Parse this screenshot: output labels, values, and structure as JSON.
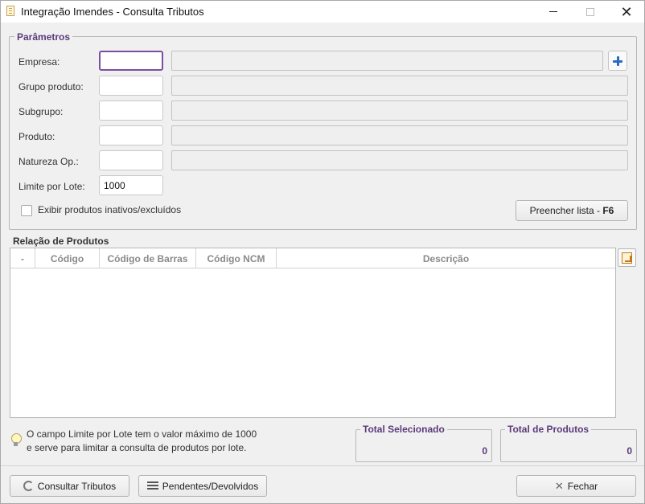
{
  "window": {
    "title": "Integração Imendes - Consulta Tributos",
    "close_glyph": "✕"
  },
  "params": {
    "legend": "Parâmetros",
    "fields": [
      {
        "label": "Empresa:",
        "code": ""
      },
      {
        "label": "Grupo produto:",
        "code": ""
      },
      {
        "label": "Subgrupo:",
        "code": ""
      },
      {
        "label": "Produto:",
        "code": ""
      },
      {
        "label": "Natureza Op.:",
        "code": ""
      }
    ],
    "limit_label": "Limite por Lote:",
    "limit_value": "1000",
    "checkbox_label": "Exibir produtos inativos/excluídos",
    "checkbox_checked": false,
    "fill_button": {
      "label": "Preencher lista - ",
      "shortcut": "F6"
    }
  },
  "products": {
    "title": "Relação de Produtos",
    "columns": [
      "-",
      "Código",
      "Código de Barras",
      "Código NCM",
      "Descrição"
    ],
    "rows": []
  },
  "info": {
    "line1": "O campo Limite por Lote tem o valor máximo de 1000",
    "line2": "e serve para limitar a consulta de produtos por lote."
  },
  "totals": {
    "selected_label": "Total Selecionado",
    "selected_value": "0",
    "products_label": "Total de Produtos",
    "products_value": "0"
  },
  "footer": {
    "consult_label": "Consultar Tributos",
    "pending_label": "Pendentes/Devolvidos",
    "close_label": "Fechar"
  },
  "colors": {
    "accent": "#5b3a7a",
    "focus_border": "#7b4fa0",
    "plus_icon": "#2a6bc2"
  }
}
